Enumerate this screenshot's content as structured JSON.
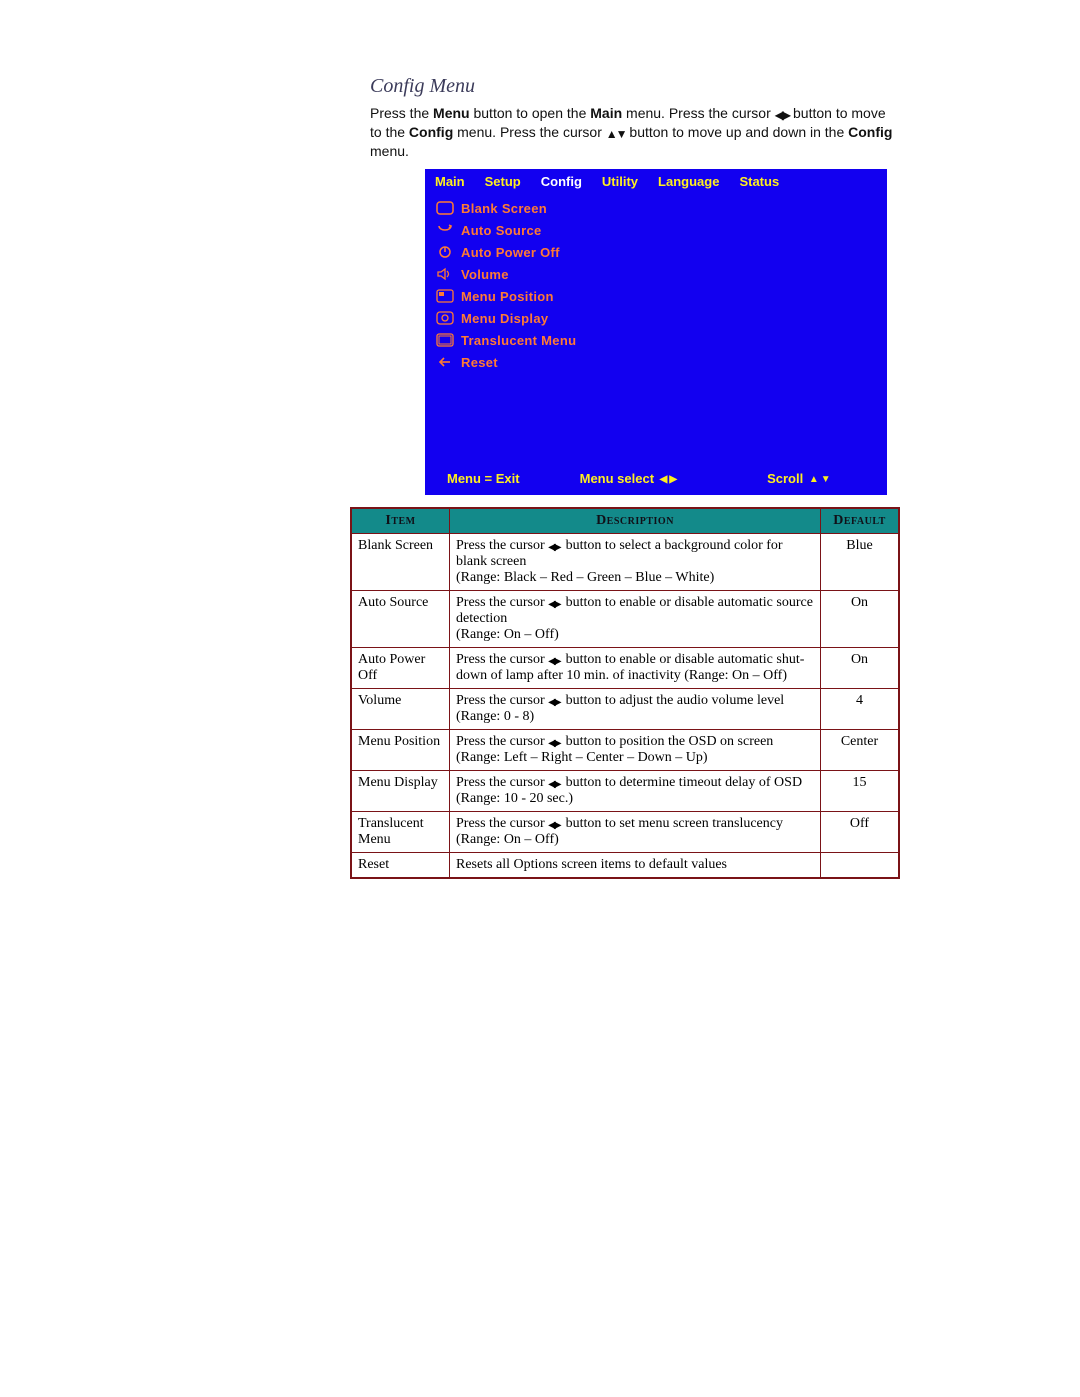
{
  "section_title": "Config Menu",
  "intro": {
    "t1": "Press the ",
    "b1": "Menu",
    "t2": " button to open the ",
    "b2": "Main",
    "t3": " menu. Press the cursor ",
    "t4": " button to move to the ",
    "b3": "Config",
    "t5": " menu. Press the cursor ",
    "t6": " button to move up and down in the ",
    "b4": "Config",
    "t7": " menu."
  },
  "osd": {
    "tabs": [
      "Main",
      "Setup",
      "Config",
      "Utility",
      "Language",
      "Status"
    ],
    "items": [
      {
        "icon": "blank-screen-icon",
        "label": "Blank Screen"
      },
      {
        "icon": "auto-source-icon",
        "label": "Auto Source"
      },
      {
        "icon": "auto-power-off-icon",
        "label": "Auto Power Off"
      },
      {
        "icon": "volume-icon",
        "label": "Volume"
      },
      {
        "icon": "menu-position-icon",
        "label": "Menu Position"
      },
      {
        "icon": "menu-display-icon",
        "label": "Menu Display"
      },
      {
        "icon": "translucent-menu-icon",
        "label": "Translucent Menu"
      },
      {
        "icon": "reset-icon",
        "label": "Reset"
      }
    ],
    "footer": {
      "menu_exit": "Menu = Exit",
      "menu_select": "Menu select",
      "scroll": "Scroll"
    }
  },
  "table": {
    "headers": {
      "item": "Item",
      "description": "Description",
      "default": "Default"
    },
    "rows": [
      {
        "item": "Blank Screen",
        "pre": "Press the cursor ",
        "post": " button to select a background color for blank screen",
        "line2": "(Range: Black – Red – Green – Blue – White)",
        "default": "Blue"
      },
      {
        "item": "Auto Source",
        "pre": "Press the cursor ",
        "post": " button to enable or disable automatic source detection",
        "line2": "(Range: On – Off)",
        "default": "On"
      },
      {
        "item": "Auto Power Off",
        "pre": "Press the cursor ",
        "post": " button to enable or disable automatic shut-down of lamp after 10 min. of inactivity (Range: On – Off)",
        "line2": "",
        "default": "On"
      },
      {
        "item": "Volume",
        "pre": "Press the cursor ",
        "post": " button to adjust the audio volume level (Range: 0 - 8)",
        "line2": "",
        "default": "4"
      },
      {
        "item": "Menu Position",
        "pre": "Press the cursor ",
        "post": " button to position the OSD on screen",
        "line2": "(Range: Left – Right – Center – Down – Up)",
        "default": "Center"
      },
      {
        "item": "Menu Display",
        "pre": "Press the cursor ",
        "post": " button to determine timeout delay of OSD",
        "line2": "(Range: 10 - 20 sec.)",
        "default": "15"
      },
      {
        "item": "Translucent Menu",
        "pre": "Press the cursor ",
        "post": " button to set menu screen translucency",
        "line2": "(Range: On – Off)",
        "default": "Off"
      },
      {
        "item": "Reset",
        "plain": "Resets all Options screen items to default values",
        "default": ""
      }
    ]
  }
}
